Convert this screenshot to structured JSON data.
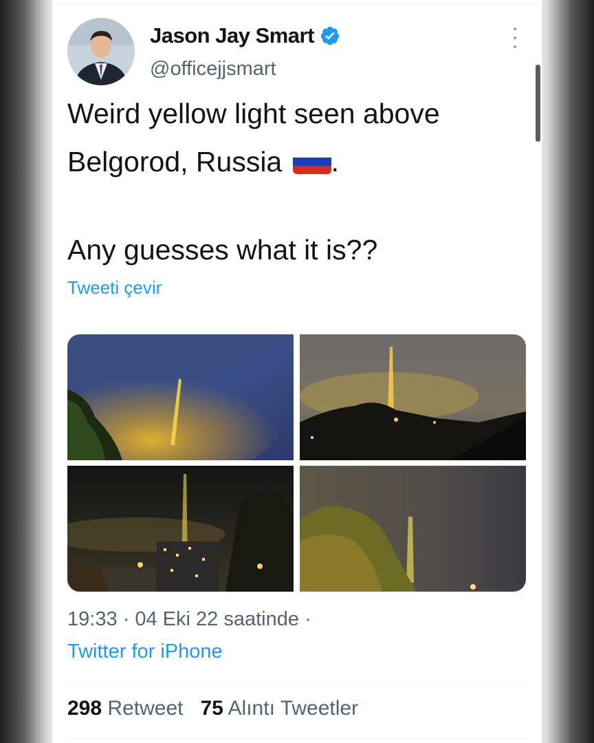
{
  "tweet": {
    "author_name": "Jason Jay Smart",
    "author_handle": "@officejjsmart",
    "verified": true,
    "text_line1": "Weird yellow light seen above",
    "text_line2": "Belgorod, Russia",
    "text_line2_suffix": ".",
    "flag_emoji": "russia-flag",
    "text_line3": "Any guesses what it is??",
    "translate_label": "Tweeti çevir",
    "photo_count": 4,
    "timestamp": "19:33 · 04 Eki 22 saatinde ·",
    "source": "Twitter for iPhone",
    "retweet_count": "298",
    "retweet_label": "Retweet",
    "quote_count": "75",
    "quote_label": "Alıntı Tweetler"
  },
  "icons": {
    "verified": "verified-badge-icon",
    "more": "more-options-icon"
  },
  "colors": {
    "link": "#1d9bf0",
    "verified": "#1d9bf0",
    "secondary_text": "#536471",
    "primary_text": "#0f1419"
  }
}
